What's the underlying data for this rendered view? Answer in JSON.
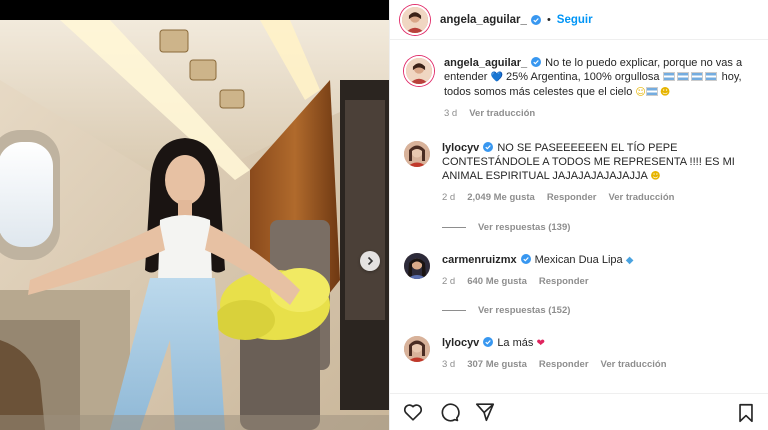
{
  "header": {
    "username": "angela_aguilar_",
    "separator": "•",
    "follow_label": "Seguir"
  },
  "caption": {
    "username": "angela_aguilar_",
    "text_part1": "No te lo puedo explicar, porque no vas a entender",
    "text_part2": "25% Argentina, 100% orgullosa",
    "text_part3": "hoy, todos somos más celestes que el cielo",
    "time": "3 d",
    "translate_label": "Ver traducción"
  },
  "comments": [
    {
      "username": "lylocyv",
      "text": "NO SE PASEEEEEEN EL TÍO PEPE CONTESTÁNDOLE A TODOS ME REPRESENTA !!!! ES MI ANIMAL ESPIRITUAL JAJAJAJAJAJAJJA",
      "time": "2 d",
      "likes": "2,049 Me gusta",
      "reply_label": "Responder",
      "translate_label": "Ver traducción",
      "view_replies": "Ver respuestas (139)"
    },
    {
      "username": "carmenruizmx",
      "text": "Mexican Dua Lipa",
      "time": "2 d",
      "likes": "640 Me gusta",
      "reply_label": "Responder",
      "view_replies": "Ver respuestas (152)"
    },
    {
      "username": "lylocyv",
      "text": "La más",
      "time": "3 d",
      "likes": "307 Me gusta",
      "reply_label": "Responder",
      "translate_label": "Ver traducción"
    }
  ],
  "icons": {
    "like": "heart-icon",
    "comment": "comment-icon",
    "share": "share-icon",
    "save": "bookmark-icon",
    "next": "chevron-right-icon",
    "verified": "verified-badge-icon"
  },
  "colors": {
    "follow": "#0095f6",
    "verified": "#3897f0",
    "muted": "#8e8e8e"
  }
}
